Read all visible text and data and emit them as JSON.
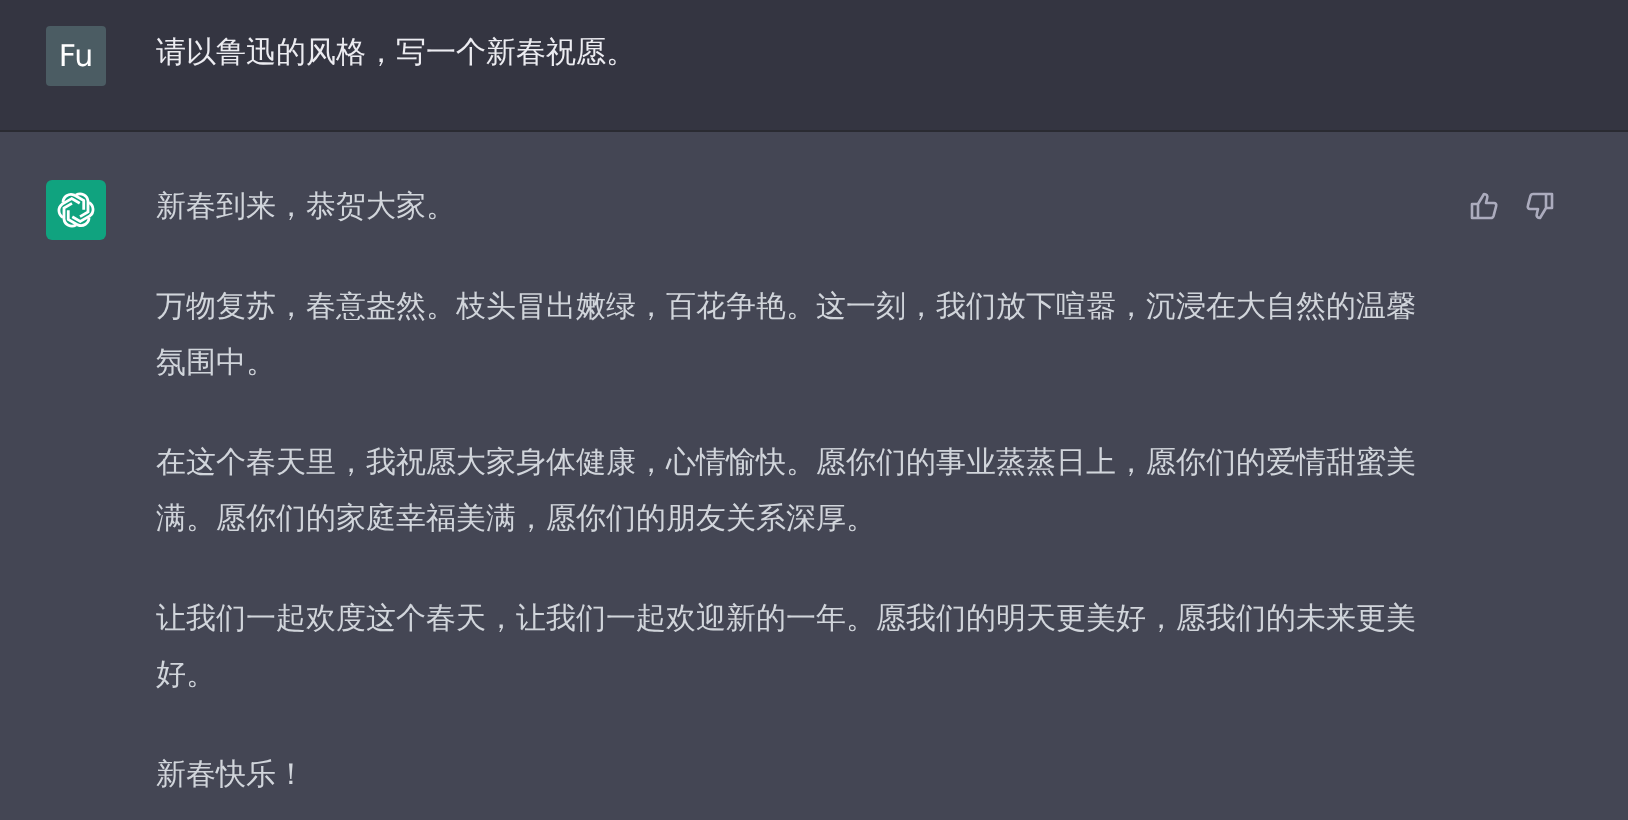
{
  "messages": [
    {
      "kind": "user",
      "avatar": "Fu",
      "paragraphs": [
        "请以鲁迅的风格，写一个新春祝愿。"
      ]
    },
    {
      "kind": "assistant",
      "paragraphs": [
        "新春到来，恭贺大家。",
        "万物复苏，春意盎然。枝头冒出嫩绿，百花争艳。这一刻，我们放下喧嚣，沉浸在大自然的温馨氛围中。",
        "在这个春天里，我祝愿大家身体健康，心情愉快。愿你们的事业蒸蒸日上，愿你们的爱情甜蜜美满。愿你们的家庭幸福美满，愿你们的朋友关系深厚。",
        "让我们一起欢度这个春天，让我们一起欢迎新的一年。愿我们的明天更美好，愿我们的未来更美好。",
        "新春快乐！"
      ]
    }
  ]
}
